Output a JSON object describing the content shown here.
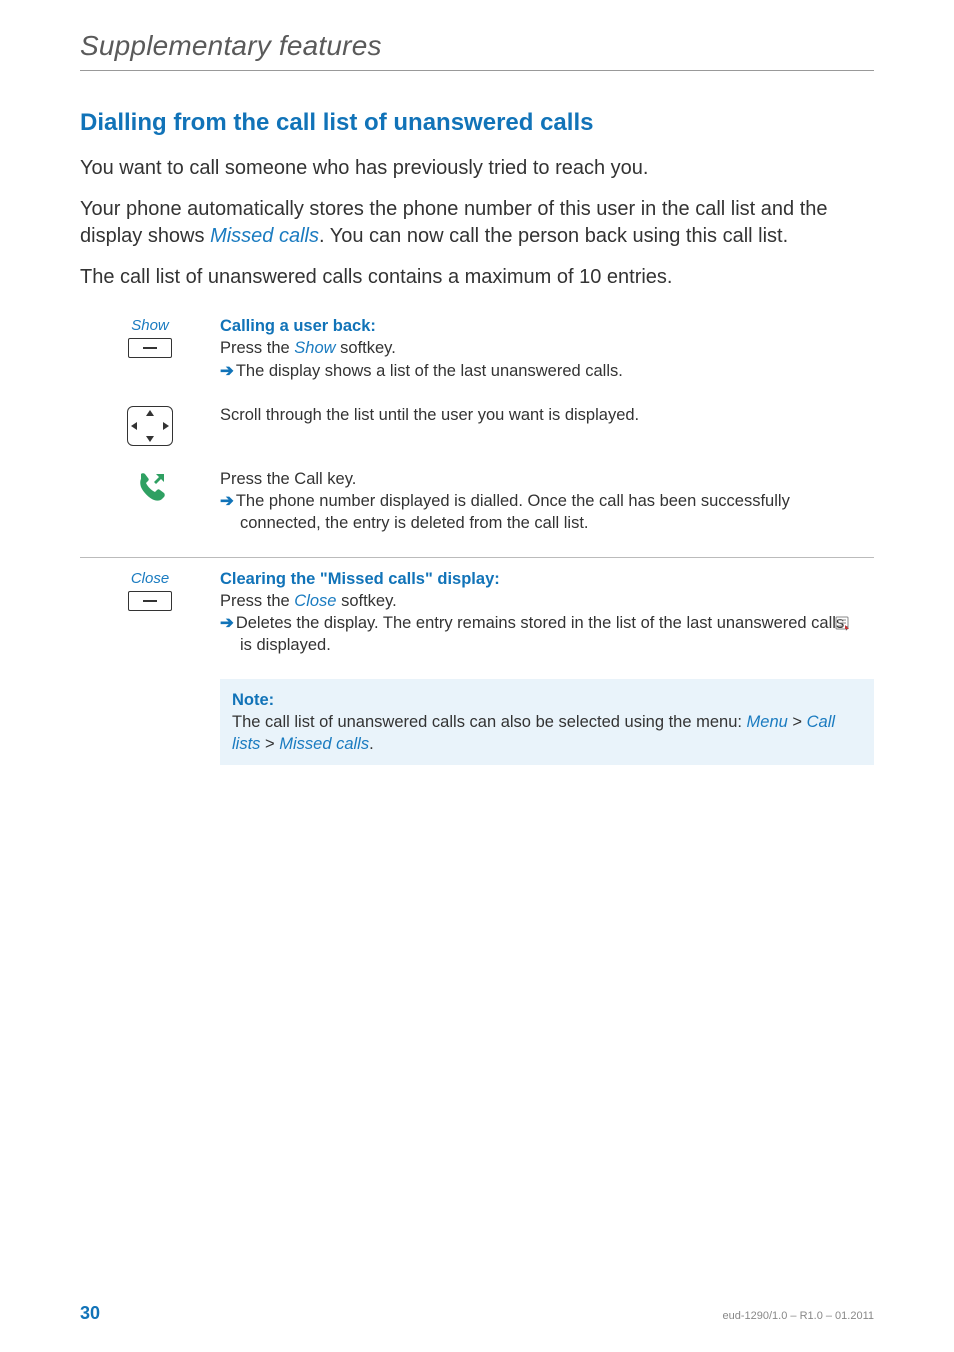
{
  "header": {
    "chapter_title": "Supplementary features"
  },
  "section": {
    "heading": "Dialling from the call list of unanswered calls",
    "para1_a": "You want to call someone who has previously tried to reach you.",
    "para2_a": "Your phone automatically stores the phone number of this user in the call list and the display shows ",
    "para2_em": "Missed calls",
    "para2_b": ". You can now call the person back using this call list.",
    "para3": "The call list of unanswered calls contains a maximum of 10 entries."
  },
  "steps": {
    "show": {
      "left_label": "Show",
      "title": "Calling a user back:",
      "line1_a": "Press the ",
      "line1_em": "Show",
      "line1_b": " softkey.",
      "line2": "The display shows a list of the last unanswered calls."
    },
    "scroll": {
      "line": "Scroll through the list until the user you want is displayed."
    },
    "call": {
      "line1": "Press the Call key.",
      "line2": "The phone number displayed is dialled. Once the call has been successfully connected, the entry is deleted from the call list."
    },
    "close": {
      "left_label": "Close",
      "title": "Clearing the \"Missed calls\" display:",
      "line1_a": "Press the ",
      "line1_em": "Close",
      "line1_b": " softkey.",
      "line2_a": "Deletes the display. The entry remains stored in the list of the last unanswered calls, ",
      "line2_b": " is displayed."
    }
  },
  "note": {
    "title": "Note:",
    "text_a": "The call list of unanswered calls can also be selected using the menu: ",
    "em1": "Menu",
    "sep1": " > ",
    "em2": "Call lists",
    "sep2": " > ",
    "em3": "Missed calls",
    "tail": "."
  },
  "footer": {
    "page": "30",
    "docid": "eud-1290/1.0 – R1.0 – 01.2011"
  }
}
